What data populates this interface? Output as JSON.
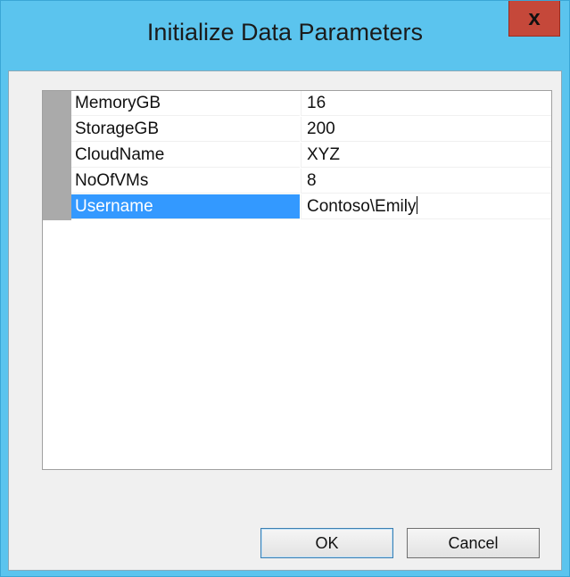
{
  "window": {
    "title": "Initialize Data Parameters",
    "close_glyph": "x"
  },
  "parameters": [
    {
      "name": "MemoryGB",
      "value": "16"
    },
    {
      "name": "StorageGB",
      "value": "200"
    },
    {
      "name": "CloudName",
      "value": "XYZ"
    },
    {
      "name": "NoOfVMs",
      "value": "8"
    },
    {
      "name": "Username",
      "value": "Contoso\\Emily",
      "selected": true
    }
  ],
  "buttons": {
    "ok_label": "OK",
    "cancel_label": "Cancel"
  },
  "colors": {
    "title_bar": "#5bc4ee",
    "close_button": "#c5483a",
    "selection": "#3399ff"
  }
}
